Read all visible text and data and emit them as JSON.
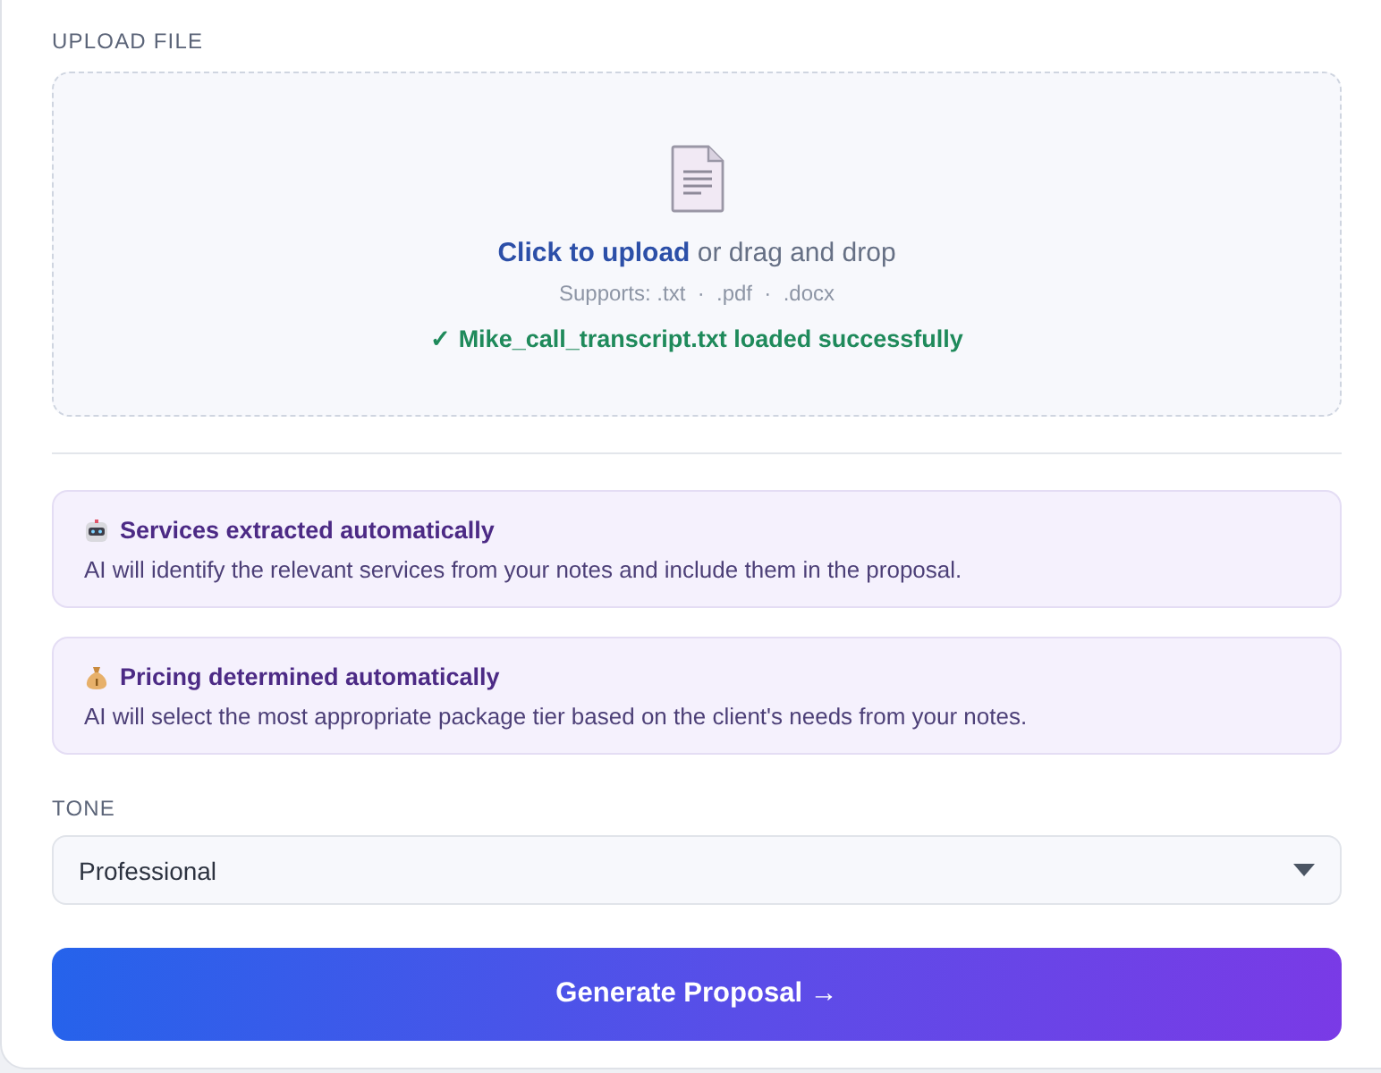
{
  "upload": {
    "label": "UPLOAD FILE",
    "link": "Click to upload",
    "prompt": "or drag and drop",
    "supports": "Supports: .txt  ·  .pdf  ·  .docx",
    "status": {
      "kind": "success",
      "text": "✓ Mike_call_transcript.txt loaded successfully"
    }
  },
  "info_cards": [
    {
      "kind": "robot",
      "title": "Services extracted automatically",
      "text": "AI will identify the relevant services from your notes and include them in the proposal."
    },
    {
      "kind": "money",
      "title": "Pricing determined automatically",
      "text": "AI will select the most appropriate package tier based on the client's needs from your notes."
    }
  ],
  "tone": {
    "label": "TONE",
    "value": "Professional"
  },
  "generate_button": "Generate Proposal →"
}
